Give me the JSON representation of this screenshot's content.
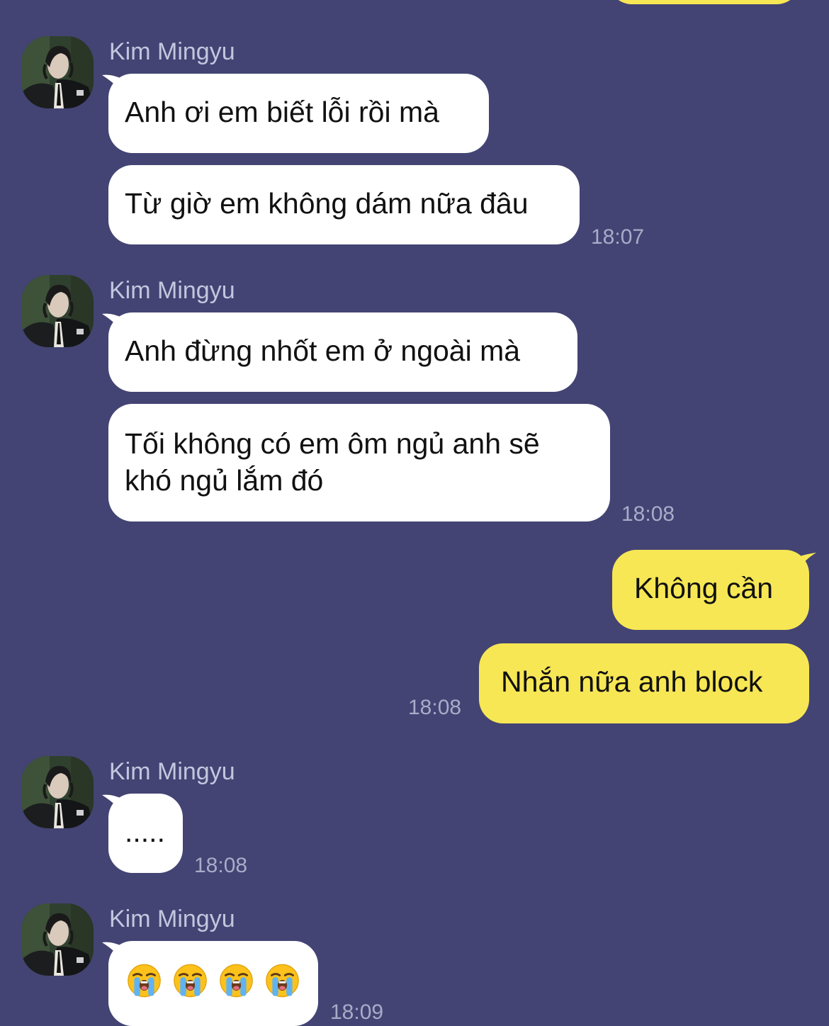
{
  "colors": {
    "background": "#434473",
    "incoming_bubble": "#ffffff",
    "outgoing_bubble": "#f7e755",
    "sender_name": "#c4c6df",
    "timestamp": "#a9abc9"
  },
  "messages": [
    {
      "sender": "Kim Mingyu",
      "bubbles": [
        "Anh ơi em biết lỗi rồi mà",
        "Từ giờ em không dám nữa đâu"
      ],
      "time": "18:07"
    },
    {
      "sender": "Kim Mingyu",
      "bubbles": [
        "Anh đừng nhốt em ở ngoài mà",
        "Tối không có em ôm ngủ anh sẽ khó ngủ lắm đó"
      ],
      "time": "18:08"
    },
    {
      "sender": "me",
      "bubbles": [
        "Không cần",
        "Nhắn nữa anh block"
      ],
      "time": "18:08"
    },
    {
      "sender": "Kim Mingyu",
      "bubbles": [
        "....."
      ],
      "time": "18:08"
    },
    {
      "sender": "Kim Mingyu",
      "bubbles": [],
      "emoji_count": 4,
      "emoji": "loudly-crying-face",
      "time": "18:09"
    }
  ]
}
